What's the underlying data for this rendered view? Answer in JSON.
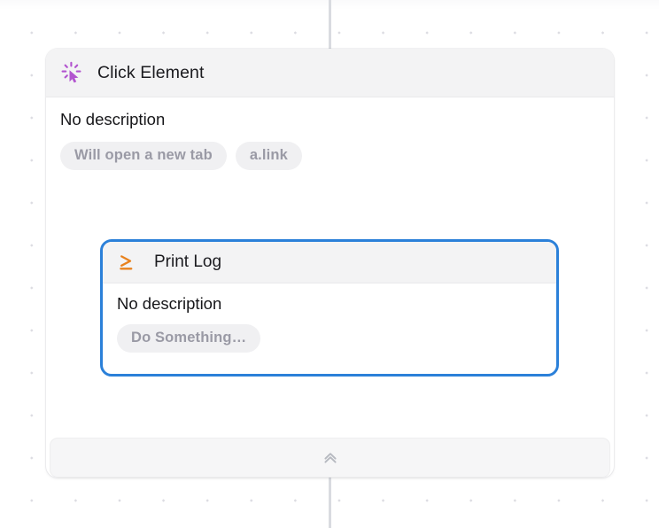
{
  "canvas": {
    "background_color": "#ffffff",
    "dot_color": "#dcdce2",
    "connector_color": "#d9dbe0"
  },
  "parent_node": {
    "icon": "click-cursor-icon",
    "icon_color": "#b254cf",
    "title": "Click Element",
    "description": "No description",
    "pills": [
      {
        "label": "Will open a new tab"
      },
      {
        "label": "a.link"
      }
    ]
  },
  "child_node": {
    "icon": "console-prompt-icon",
    "icon_color": "#e8821e",
    "selected": true,
    "selection_color": "#2b80d9",
    "title": "Print Log",
    "description": "No description",
    "pills": [
      {
        "label": "Do Something…"
      }
    ]
  },
  "collapse_bar": {
    "icon": "chevron-double-up-icon",
    "icon_color": "#b6b9c0"
  }
}
